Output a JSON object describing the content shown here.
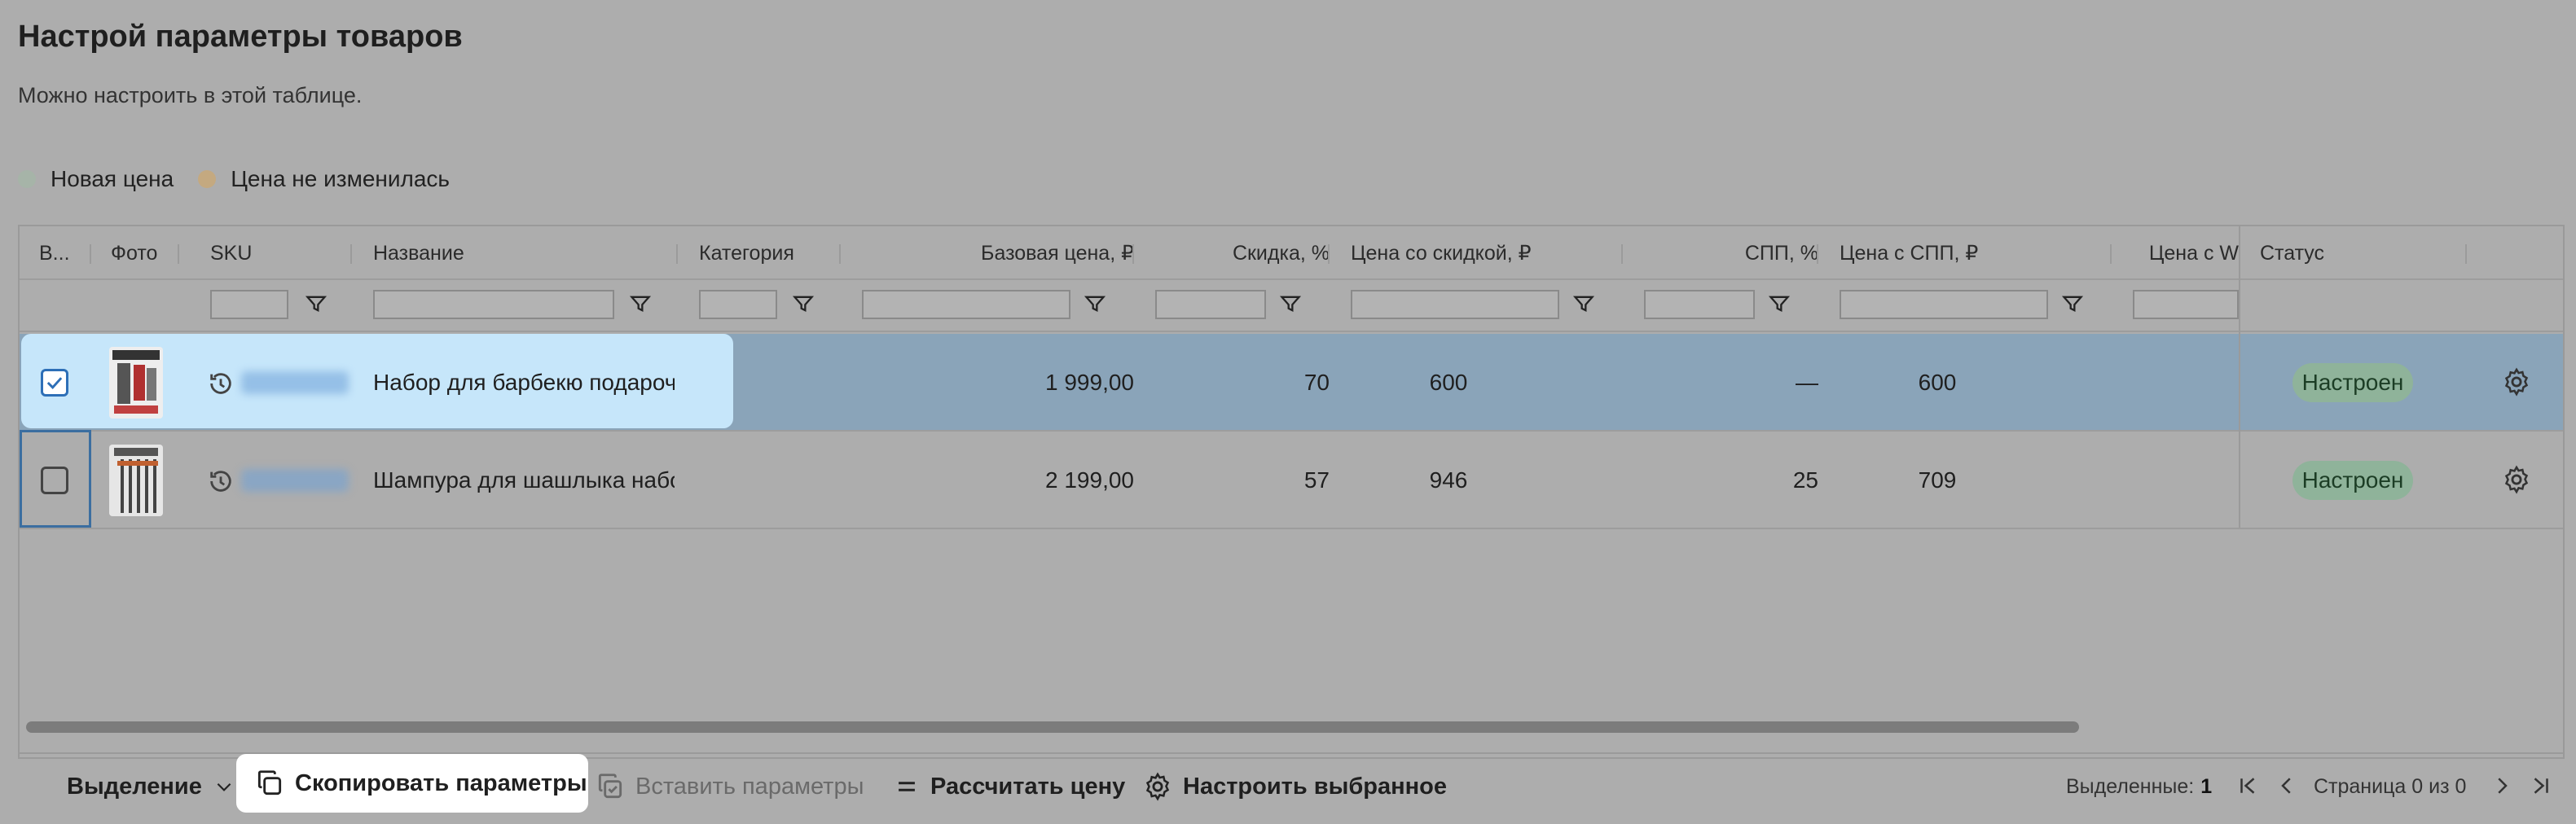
{
  "page": {
    "title": "Настрой параметры товаров",
    "subtitle": "Можно настроить в этой таблице."
  },
  "legend": {
    "items": [
      {
        "label": "Новая цена",
        "color": "#a6b4a8"
      },
      {
        "label": "Цена не изменилась",
        "color": "#c4a980"
      }
    ]
  },
  "table": {
    "columns": [
      {
        "label": "В..."
      },
      {
        "label": "Фото"
      },
      {
        "label": "SKU"
      },
      {
        "label": "Название"
      },
      {
        "label": "Категория"
      },
      {
        "label": "Базовая цена, ₽"
      },
      {
        "label": "Скидка, %"
      },
      {
        "label": "Цена со скидкой, ₽"
      },
      {
        "label": "СПП, %"
      },
      {
        "label": "Цена с СПП, ₽"
      },
      {
        "label": "Цена с W"
      },
      {
        "label": "Статус"
      }
    ],
    "rows": [
      {
        "selected": true,
        "name": "Набор для барбекю подароч",
        "category": "",
        "base_price": "1 999,00",
        "discount": "70",
        "price_discount": "600",
        "spp": "—",
        "price_spp": "600",
        "status": "Настроен"
      },
      {
        "selected": false,
        "name": "Шампура для шашлыка набо",
        "category": "",
        "base_price": "2 199,00",
        "discount": "57",
        "price_discount": "946",
        "spp": "25",
        "price_spp": "709",
        "status": "Настроен"
      }
    ]
  },
  "toolbar": {
    "selection_label": "Выделение",
    "copy_label": "Скопировать параметры",
    "paste_label": "Вставить параметры",
    "calc_label": "Рассчитать цену",
    "configure_label": "Настроить выбранное",
    "selected_prefix": "Выделенные:",
    "selected_count": "1",
    "page_info": "Страница 0 из 0"
  },
  "colors": {
    "accent": "#2d6fb7",
    "selected_row": "#8aa4b9",
    "status_badge": "#8fb39a"
  }
}
